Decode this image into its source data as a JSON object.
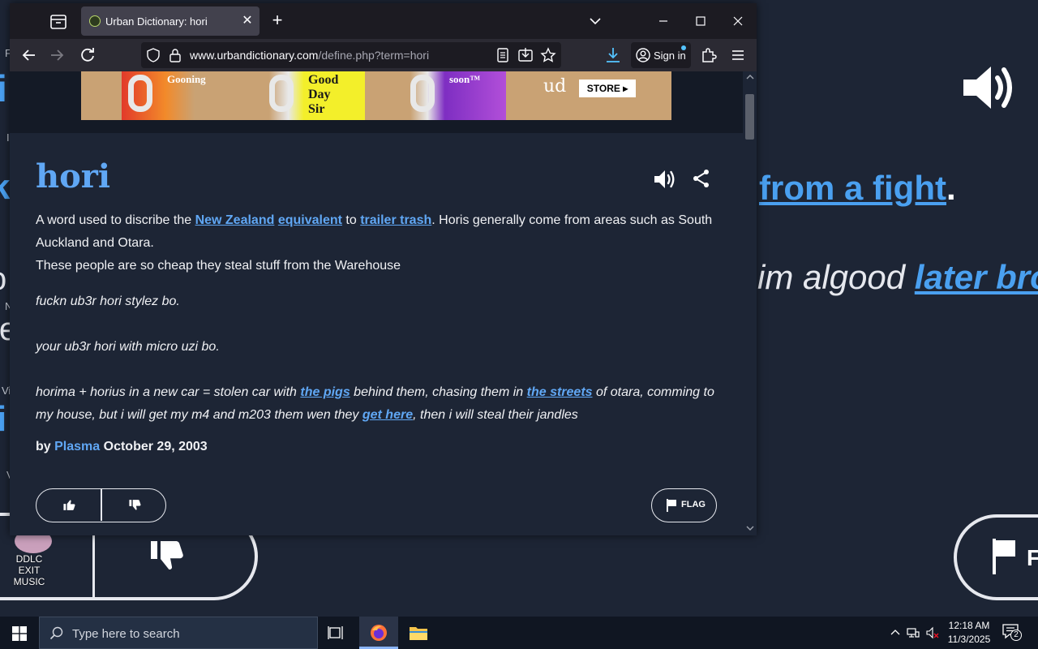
{
  "tab": {
    "title": "Urban Dictionary: hori"
  },
  "address": {
    "host": "www.urbandictionary.com",
    "path": "/define.php?term=hori"
  },
  "account": {
    "signin_label": "Sign in"
  },
  "banner": {
    "mug1": "Gooning",
    "mug2_l1": "Good",
    "mug2_l2": "Day",
    "mug2_l3": "Sir",
    "mug3": "soon™",
    "brand": "ud",
    "store": "STORE ▸"
  },
  "definition": {
    "word": "hori",
    "meaning": {
      "t1": "A word used to discribe the ",
      "l1": "New Zealand",
      "t2": " ",
      "l2": "equivalent",
      "t3": " to ",
      "l3": "trailer trash",
      "t4": ". Horis generally come from areas such as South Auckland and Otara.",
      "line2": "These people are so cheap they steal stuff from the Warehouse"
    },
    "example": {
      "p1": "fuckn ub3r hori stylez bo.",
      "p2": "your ub3r hori with micro uzi bo.",
      "p3_t1": "horima + horius in a new car = stolen car with ",
      "p3_l1": "the pigs",
      "p3_t2": " behind them, chasing them in ",
      "p3_l2": "the streets",
      "p3_t3": " of otara, comming to my house, but i will get my m4 and m203 them wen they ",
      "p3_l3": "get here",
      "p3_t4": ", then i will steal their jandles"
    },
    "by": "by",
    "author": "Plasma",
    "date": "October 29, 2003",
    "flag_label": "FLAG"
  },
  "background": {
    "fight_link": "from a fight",
    "fight_period": ".",
    "algood_text": "im algood ",
    "algood_link": "later bro",
    "flag_letter": "F",
    "frag_l1": "i",
    "frag_l2": "ki",
    "frag_l3": "o",
    "frag_l4": "ie",
    "frag_l5": "i",
    "frag_s1": "F",
    "frag_s2": "I",
    "frag_s3": "N",
    "frag_s4": "Vi",
    "frag_s5": "V"
  },
  "desktop_icon": {
    "label_l1": "DDLC EXIT",
    "label_l2": "MUSIC"
  },
  "taskbar": {
    "search_placeholder": "Type here to search",
    "time": "12:18 AM",
    "date": "11/3/2025",
    "notification_count": "2"
  },
  "colors": {
    "page_bg": "#1d2535",
    "link": "#60a7f4",
    "browser_chrome": "#2b2a33",
    "tabbar": "#1c1b22",
    "taskbar": "#101622"
  }
}
